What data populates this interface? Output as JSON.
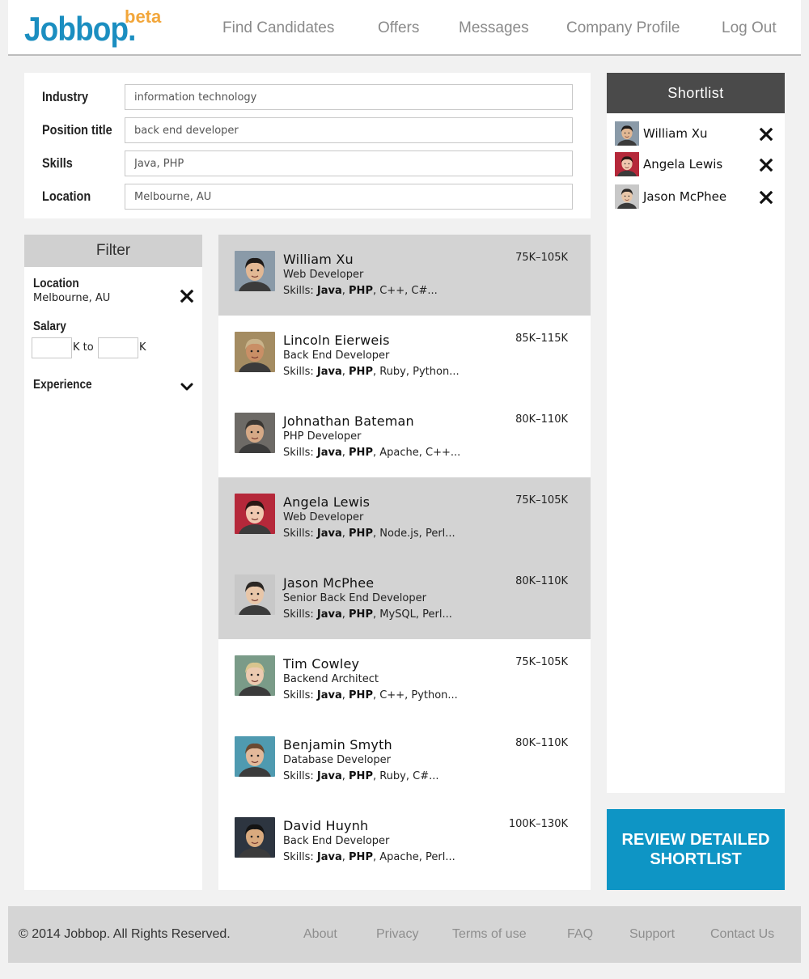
{
  "header": {
    "logo_text": "Jobbop.",
    "logo_badge": "beta",
    "nav": [
      "Find Candidates",
      "Offers",
      "Messages",
      "Company Profile",
      "Log Out"
    ]
  },
  "search": {
    "industry_label": "Industry",
    "industry_value": "information technology",
    "position_label": "Position title",
    "position_value": "back end developer",
    "skills_label": "Skills",
    "skills_value": "Java, PHP",
    "location_label": "Location",
    "location_value": "Melbourne, AU"
  },
  "filter": {
    "title": "Filter",
    "location_label": "Location",
    "location_value": "Melbourne, AU",
    "salary_label": "Salary",
    "salary_k_to": "K to",
    "salary_k": "K",
    "experience_label": "Experience"
  },
  "results": [
    {
      "name": "William Xu",
      "title": "Web Developer",
      "skills_prefix": "Skills: ",
      "skill1": "Java",
      "sep": ", ",
      "skill2": "PHP",
      "skills_rest": ", C++, C#...",
      "salary": "75K–105K",
      "highlighted": true
    },
    {
      "name": "Lincoln Eierweis",
      "title": "Back End Developer",
      "skills_prefix": "Skills: ",
      "skill1": "Java",
      "sep": ", ",
      "skill2": "PHP",
      "skills_rest": ", Ruby, Python...",
      "salary": "85K–115K",
      "highlighted": false
    },
    {
      "name": "Johnathan Bateman",
      "title": "PHP Developer",
      "skills_prefix": "Skills: ",
      "skill1": "Java",
      "sep": ", ",
      "skill2": "PHP",
      "skills_rest": ", Apache, C++...",
      "salary": "80K–110K",
      "highlighted": false
    },
    {
      "name": "Angela Lewis",
      "title": "Web Developer",
      "skills_prefix": "Skills: ",
      "skill1": "Java",
      "sep": ", ",
      "skill2": "PHP",
      "skills_rest": ", Node.js, Perl...",
      "salary": "75K–105K",
      "highlighted": true
    },
    {
      "name": "Jason McPhee",
      "title": "Senior Back End Developer",
      "skills_prefix": "Skills: ",
      "skill1": "Java",
      "sep": ", ",
      "skill2": "PHP",
      "skills_rest": ", MySQL, Perl...",
      "salary": "80K–110K",
      "highlighted": true
    },
    {
      "name": "Tim Cowley",
      "title": "Backend Architect",
      "skills_prefix": "Skills: ",
      "skill1": "Java",
      "sep": ", ",
      "skill2": "PHP",
      "skills_rest": ", C++, Python...",
      "salary": "75K–105K",
      "highlighted": false
    },
    {
      "name": "Benjamin Smyth",
      "title": "Database Developer",
      "skills_prefix": "Skills: ",
      "skill1": "Java",
      "sep": ", ",
      "skill2": "PHP",
      "skills_rest": ", Ruby, C#...",
      "salary": "80K–110K",
      "highlighted": false
    },
    {
      "name": "David Huynh",
      "title": "Back End Developer",
      "skills_prefix": "Skills: ",
      "skill1": "Java",
      "sep": ", ",
      "skill2": "PHP",
      "skills_rest": ", Apache, Perl...",
      "salary": "100K–130K",
      "highlighted": false
    }
  ],
  "shortlist": {
    "title": "Shortlist",
    "items": [
      {
        "name": "William Xu"
      },
      {
        "name": "Angela Lewis"
      },
      {
        "name": "Jason McPhee"
      }
    ],
    "review_button": "REVIEW DETAILED SHORTLIST"
  },
  "footer": {
    "copyright": "© 2014 Jobbop. All Rights Reserved.",
    "links": [
      "About",
      "Privacy",
      "Terms of use",
      "FAQ",
      "Support",
      "Contact Us"
    ]
  },
  "colors": {
    "brand_blue": "#1b8ec0",
    "beta_orange": "#f2a63a",
    "button_blue": "#0e95c5",
    "shortlist_header": "#4a4a4a",
    "highlight_row": "#d3d3d3"
  },
  "icons": [
    "close-icon",
    "chevron-down-icon",
    "avatar-photo"
  ]
}
